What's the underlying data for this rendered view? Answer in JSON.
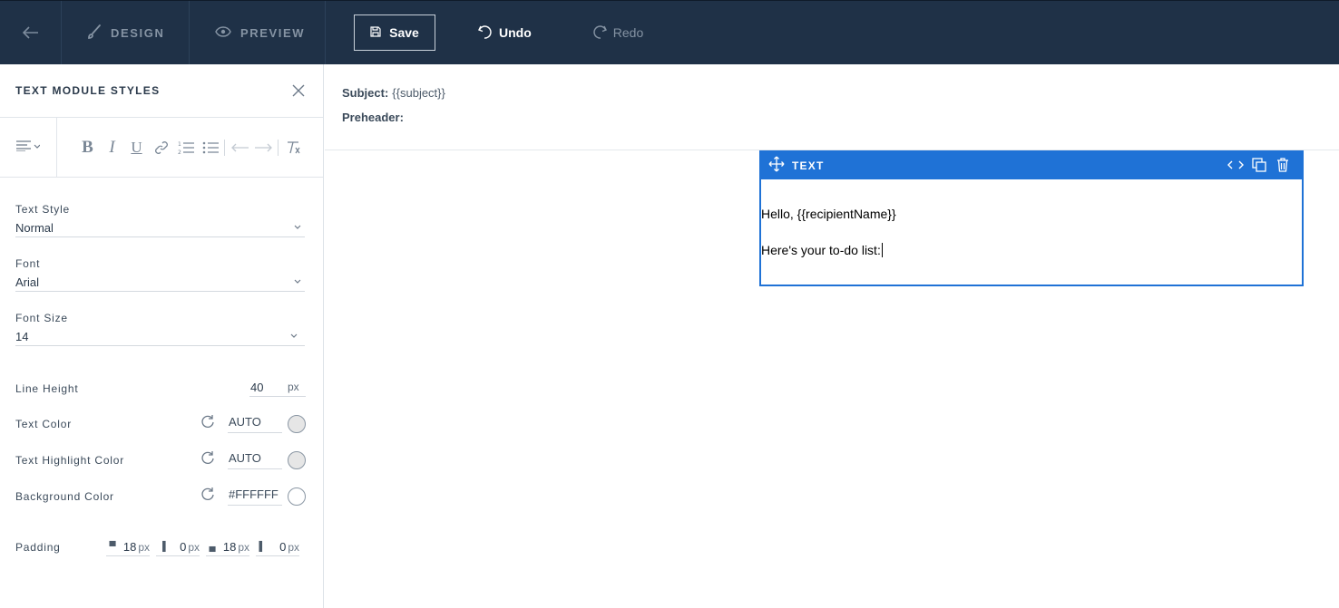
{
  "topbar": {
    "tabs": [
      {
        "label": "DESIGN",
        "icon": "brush-icon"
      },
      {
        "label": "PREVIEW",
        "icon": "eye-icon"
      }
    ],
    "save_label": "Save",
    "undo_label": "Undo",
    "redo_label": "Redo"
  },
  "panel": {
    "title": "TEXT MODULE STYLES",
    "text_style": {
      "label": "Text Style",
      "value": "Normal"
    },
    "font": {
      "label": "Font",
      "value": "Arial"
    },
    "font_size": {
      "label": "Font Size",
      "value": "14"
    },
    "line_height": {
      "label": "Line Height",
      "value": "40",
      "unit": "px"
    },
    "text_color": {
      "label": "Text Color",
      "value": "AUTO",
      "swatch": "#e6e6e6"
    },
    "highlight_color": {
      "label": "Text Highlight Color",
      "value": "AUTO",
      "swatch": "#e6e6e6"
    },
    "background_color": {
      "label": "Background Color",
      "value": "#FFFFFF",
      "swatch": "#FFFFFF"
    },
    "padding": {
      "label": "Padding",
      "top": "18",
      "right": "0",
      "bottom": "18",
      "left": "0",
      "unit": "px"
    }
  },
  "canvas": {
    "subject_label": "Subject:",
    "subject_value": "{{subject}}",
    "preheader_label": "Preheader:",
    "module": {
      "title": "TEXT",
      "lines": [
        "Hello, {{recipientName}}",
        "Here's your to-do list:"
      ]
    }
  },
  "colors": {
    "topbar": "#1f3147",
    "accent": "#1f72d6"
  }
}
